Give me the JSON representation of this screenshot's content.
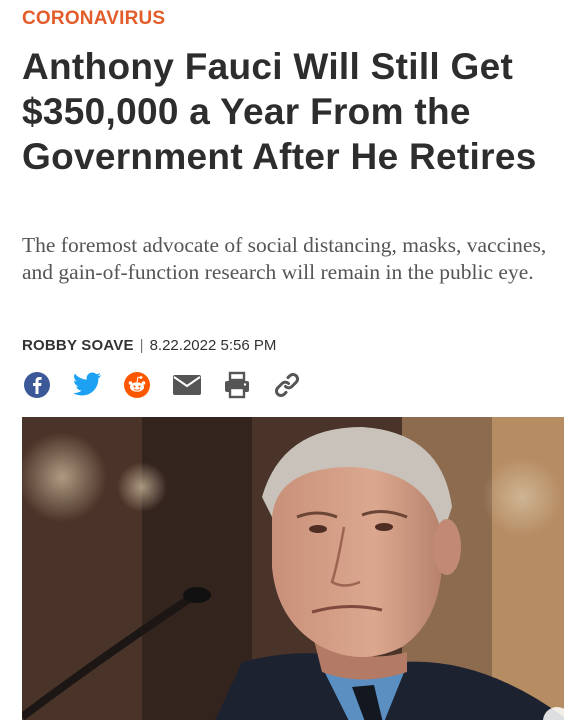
{
  "article": {
    "category": "CORONAVIRUS",
    "headline": "Anthony Fauci Will Still Get $350,000 a Year From the Government After He Retires",
    "dek": "The foremost advocate of social distancing, masks, vaccines, and gain-of-function research will remain in the public eye.",
    "author": "ROBBY SOAVE",
    "separator": "|",
    "date": "8.22.2022 5:56 PM"
  },
  "share_icons": [
    "facebook-icon",
    "twitter-icon",
    "reddit-icon",
    "email-icon",
    "print-icon",
    "link-icon"
  ],
  "colors": {
    "accent": "#e35d2b",
    "facebook": "#3b5998",
    "twitter": "#1da1f2",
    "reddit": "#ff5700",
    "icon_gray": "#555555"
  }
}
